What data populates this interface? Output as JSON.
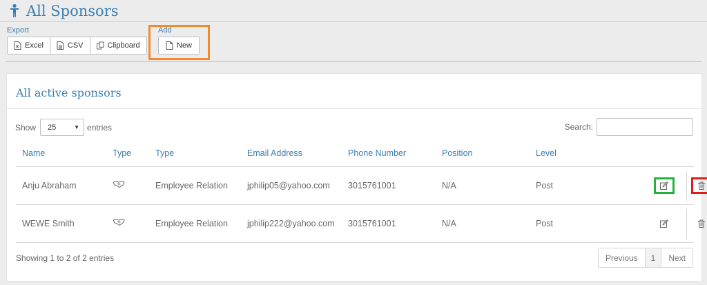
{
  "header": {
    "title": "All Sponsors"
  },
  "export": {
    "label": "Export",
    "buttons": {
      "excel": "Excel",
      "csv": "CSV",
      "clipboard": "Clipboard"
    }
  },
  "add": {
    "label": "Add",
    "new_label": "New"
  },
  "panel": {
    "title": "All active sponsors"
  },
  "length": {
    "show": "Show",
    "value": "25",
    "entries": "entries"
  },
  "search": {
    "label": "Search:",
    "value": ""
  },
  "table": {
    "columns": [
      "Name",
      "Type",
      "Type",
      "Email Address",
      "Phone Number",
      "Position",
      "Level"
    ],
    "rows": [
      {
        "name": "Anju Abraham",
        "type_icon": "handshake-icon",
        "type": "Employee Relation",
        "email": "jphilip05@yahoo.com",
        "phone": "3015761001",
        "position": "N/A",
        "level": "Post"
      },
      {
        "name": "WEWE Smith",
        "type_icon": "handshake-icon",
        "type": "Employee Relation",
        "email": "jphilip222@yahoo.com",
        "phone": "3015761001",
        "position": "N/A",
        "level": "Post"
      }
    ]
  },
  "footer": {
    "info": "Showing 1 to 2 of 2 entries"
  },
  "pagination": {
    "previous": "Previous",
    "current": "1",
    "next": "Next"
  },
  "colors": {
    "accent": "#3a7fb3",
    "highlight_add": "#f28a2d",
    "highlight_edit": "#22b33a",
    "highlight_delete": "#e01b1b"
  }
}
